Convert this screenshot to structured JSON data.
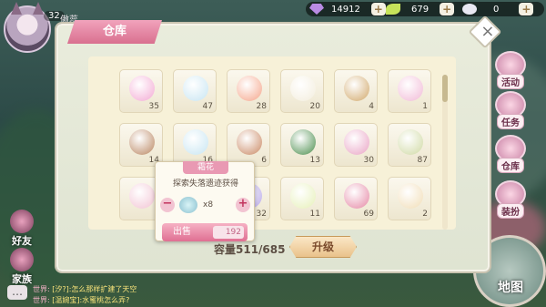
{
  "player": {
    "level": "32",
    "name": "傲蕊"
  },
  "resources": [
    {
      "name": "crystal",
      "value": "14912",
      "color": "#b98be3"
    },
    {
      "name": "leaf-coin",
      "value": "679",
      "color": "#c6e35a"
    },
    {
      "name": "pet-food",
      "value": "0",
      "color": "#e9e9f3"
    }
  ],
  "warehouse": {
    "title": "仓库",
    "capacity_label": "容量511/685",
    "upgrade_label": "升级",
    "items": [
      {
        "count": "35",
        "color": "#f3a9d3"
      },
      {
        "count": "47",
        "color": "#c7e5f2"
      },
      {
        "count": "28",
        "color": "#f5a58a"
      },
      {
        "count": "20",
        "color": "#f3eddc"
      },
      {
        "count": "4",
        "color": "#d1a86a"
      },
      {
        "count": "1",
        "color": "#f1b9d6"
      },
      {
        "count": "14",
        "color": "#b98560"
      },
      {
        "count": "16",
        "color": "#c7e5f2"
      },
      {
        "count": "6",
        "color": "#c98863"
      },
      {
        "count": "13",
        "color": "#4a8d4c"
      },
      {
        "count": "30",
        "color": "#e9a3c4"
      },
      {
        "count": "87",
        "color": "#cfd9a3"
      },
      {
        "count": "",
        "color": "#f2c3d3"
      },
      {
        "count": "32",
        "color": "#b6a6e8"
      },
      {
        "count": "11",
        "color": "#e6f0b8"
      },
      {
        "count": "69",
        "color": "#e587a5"
      },
      {
        "count": "2",
        "color": "#f1ddb6"
      }
    ]
  },
  "tooltip": {
    "name": "霜花",
    "description": "探索失落遗迹获得",
    "quantity": "x8",
    "sell_label": "出售",
    "price": "192"
  },
  "side_menu": [
    "活动",
    "任务",
    "仓库",
    "装扮"
  ],
  "left_menu": [
    "好友",
    "家族"
  ],
  "map_label": "地图",
  "chat": [
    {
      "who": "世界:",
      "text": "[汐?]:怎么那样扩建了天空"
    },
    {
      "who": "世界:",
      "text": "[温婉宝]:水蜜桃怎么弄?"
    }
  ]
}
